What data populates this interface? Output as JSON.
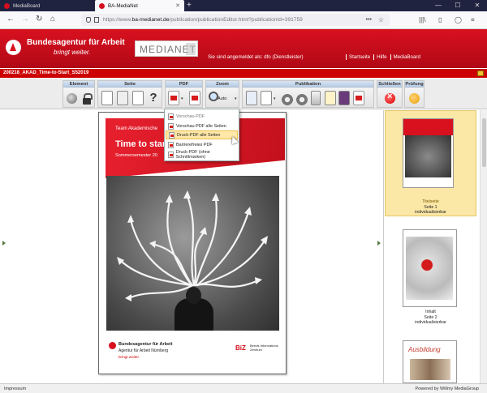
{
  "browser": {
    "tabs": [
      {
        "label": "MediaBoard"
      },
      {
        "label": "BA-MediaNet"
      }
    ],
    "url_prefix": "https://www.",
    "url_host": "ba-medianet.de",
    "url_path": "/publication/publicationEditor.html?publicationId=391759"
  },
  "header": {
    "brand": "Bundesagentur für Arbeit",
    "brand_sub": "bringt weiter.",
    "medianet": "MEDIANET",
    "logged_in": "Sie sind angemeldet als: dfo (Dienstleister)",
    "links": [
      "Startseite",
      "Hilfe",
      "MediaBoard"
    ]
  },
  "publication_title": "200218_AKAD_Time-to-Start_S52019",
  "toolbar": {
    "groups": {
      "element": "Element",
      "seite": "Seite",
      "pdf": "PDF",
      "zoom": "Zoom",
      "publikation": "Publikation",
      "schliessen": "Schließen",
      "pruefung": "Prüfung"
    },
    "zoom_value": "Auto"
  },
  "pdf_menu": {
    "items": [
      "Vorschau-PDF",
      "Vorschau-PDF alle Seiten",
      "Druck-PDF alle Seiten",
      "Barrierefreies PDF",
      "Druck-PDF (ohne Schnittmarken)"
    ]
  },
  "page_preview": {
    "team": "Team Akademische",
    "title": "Time to start",
    "semester": "Sommersemester 20",
    "footer_brand": "Bundesagentur für Arbeit",
    "footer_org": "Agentur für Arbeit Nürnberg",
    "footer_claim": "bringt weiter.",
    "biz_logo": "BiZ",
    "biz_text": "Berufs Informations Zentrum"
  },
  "thumbnails": [
    {
      "caption": [
        "Titelseite",
        "Seite 1",
        "individualisierbar"
      ]
    },
    {
      "caption": [
        "Inhalt",
        "Seite 2",
        "individualisierbar"
      ]
    },
    {
      "caption": []
    }
  ],
  "thumb3_text": "Ausbildung",
  "status": {
    "left": "Impressum",
    "right": "Powered by Willmy MediaGroup"
  }
}
